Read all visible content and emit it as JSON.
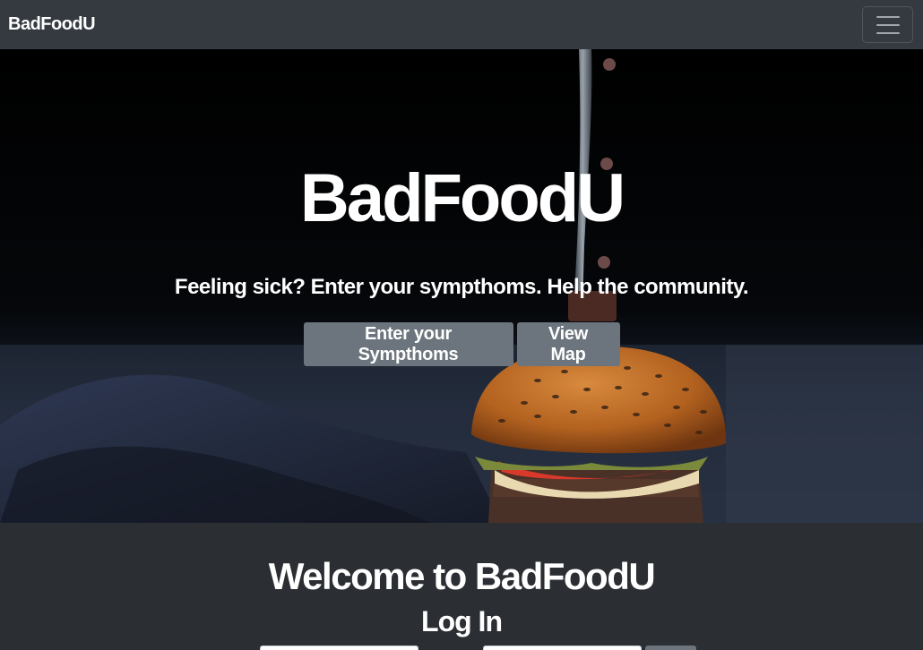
{
  "navbar": {
    "brand": "BadFoodU",
    "toggler_icon": "hamburger-menu-icon"
  },
  "hero": {
    "title": "BadFoodU",
    "subtitle": "Feeling sick? Enter your sympthoms. Help the community.",
    "buttons": {
      "enter_symptoms": "Enter your Sympthoms",
      "view_map": "View Map"
    }
  },
  "main": {
    "welcome": "Welcome to BadFoodU",
    "login_title": "Log In",
    "username_value": "",
    "password_value": ""
  },
  "colors": {
    "navbar_bg": "#343a40",
    "page_bg": "#2b2e33",
    "button_bg": "#6c757d"
  }
}
